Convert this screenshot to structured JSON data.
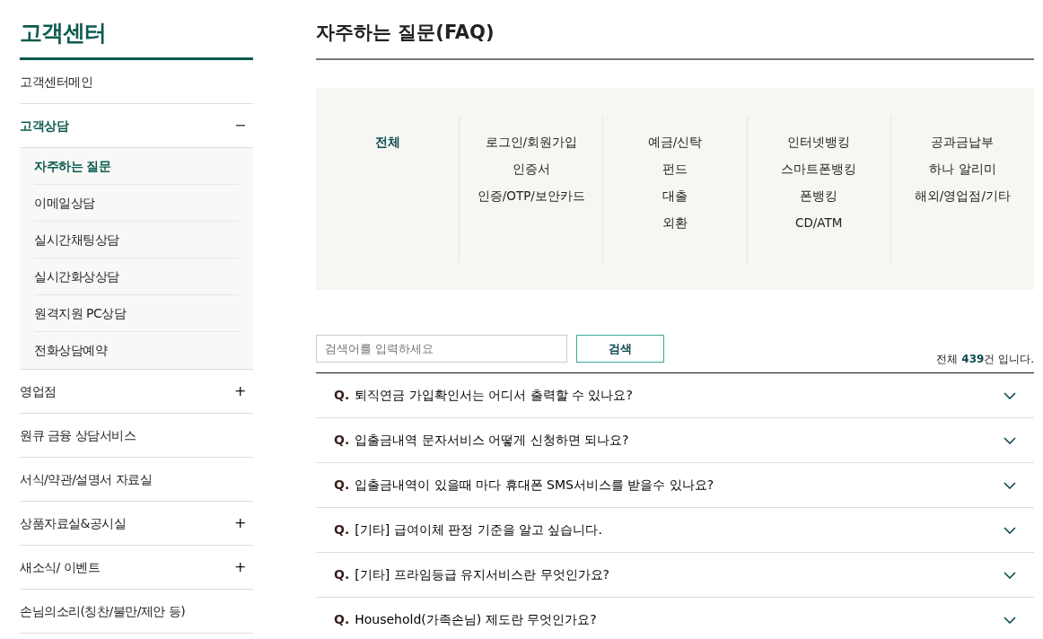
{
  "sidebar": {
    "title": "고객센터",
    "items": [
      {
        "label": "고객센터메인",
        "selected": false
      },
      {
        "label": "고객상담",
        "selected": true,
        "toggle": "−",
        "expanded": true,
        "children": [
          {
            "label": "자주하는 질문",
            "selected": true
          },
          {
            "label": "이메일상담",
            "selected": false
          },
          {
            "label": "실시간채팅상담",
            "selected": false
          },
          {
            "label": "실시간화상상담",
            "selected": false
          },
          {
            "label": "원격지원 PC상담",
            "selected": false
          },
          {
            "label": "전화상담예약",
            "selected": false
          }
        ]
      },
      {
        "label": "영업점",
        "selected": false,
        "toggle": "+",
        "expanded": false
      },
      {
        "label": "원큐 금융 상담서비스",
        "selected": false
      },
      {
        "label": "서식/약관/설명서 자료실",
        "selected": false
      },
      {
        "label": "상품자료실&공시실",
        "selected": false,
        "toggle": "+",
        "expanded": false
      },
      {
        "label": "새소식/ 이벤트",
        "selected": false,
        "toggle": "+",
        "expanded": false
      },
      {
        "label": "손님의소리(칭찬/불만/제안 등)",
        "selected": false
      }
    ]
  },
  "main": {
    "title": "자주하는 질문(FAQ)",
    "category_columns": [
      [
        {
          "label": "전체",
          "selected": true
        }
      ],
      [
        {
          "label": "로그인/회원가입",
          "selected": false
        },
        {
          "label": "인증서",
          "selected": false
        },
        {
          "label": "인증/OTP/보안카드",
          "selected": false
        }
      ],
      [
        {
          "label": "예금/신탁",
          "selected": false
        },
        {
          "label": "펀드",
          "selected": false
        },
        {
          "label": "대출",
          "selected": false
        },
        {
          "label": "외환",
          "selected": false
        }
      ],
      [
        {
          "label": "인터넷뱅킹",
          "selected": false
        },
        {
          "label": "스마트폰뱅킹",
          "selected": false
        },
        {
          "label": "폰뱅킹",
          "selected": false
        },
        {
          "label": "CD/ATM",
          "selected": false
        }
      ],
      [
        {
          "label": "공과금납부",
          "selected": false
        },
        {
          "label": "하나 알리미",
          "selected": false
        },
        {
          "label": "해외/영업점/기타",
          "selected": false
        }
      ]
    ],
    "search": {
      "placeholder": "검색어를 입력하세요",
      "button": "검색"
    },
    "count": "전체 **439**건 입니다.",
    "faq": [
      {
        "q": "Q.",
        "text": "퇴직연금 가입확인서는 어디서 출력할 수 있나요?"
      },
      {
        "q": "Q.",
        "text": "입출금내역 문자서비스 어떻게 신청하면 되나요?"
      },
      {
        "q": "Q.",
        "text": "입출금내역이 있을때 마다 휴대폰 SMS서비스를 받을수 있나요?"
      },
      {
        "q": "Q.",
        "text": "[기타] 급여이체 판정 기준을 알고 싶습니다."
      },
      {
        "q": "Q.",
        "text": "[기타] 프라임등급 유지서비스란 무엇인가요?"
      },
      {
        "q": "Q.",
        "text": "Household(가족손님) 제도란 무엇인가요?"
      }
    ]
  }
}
